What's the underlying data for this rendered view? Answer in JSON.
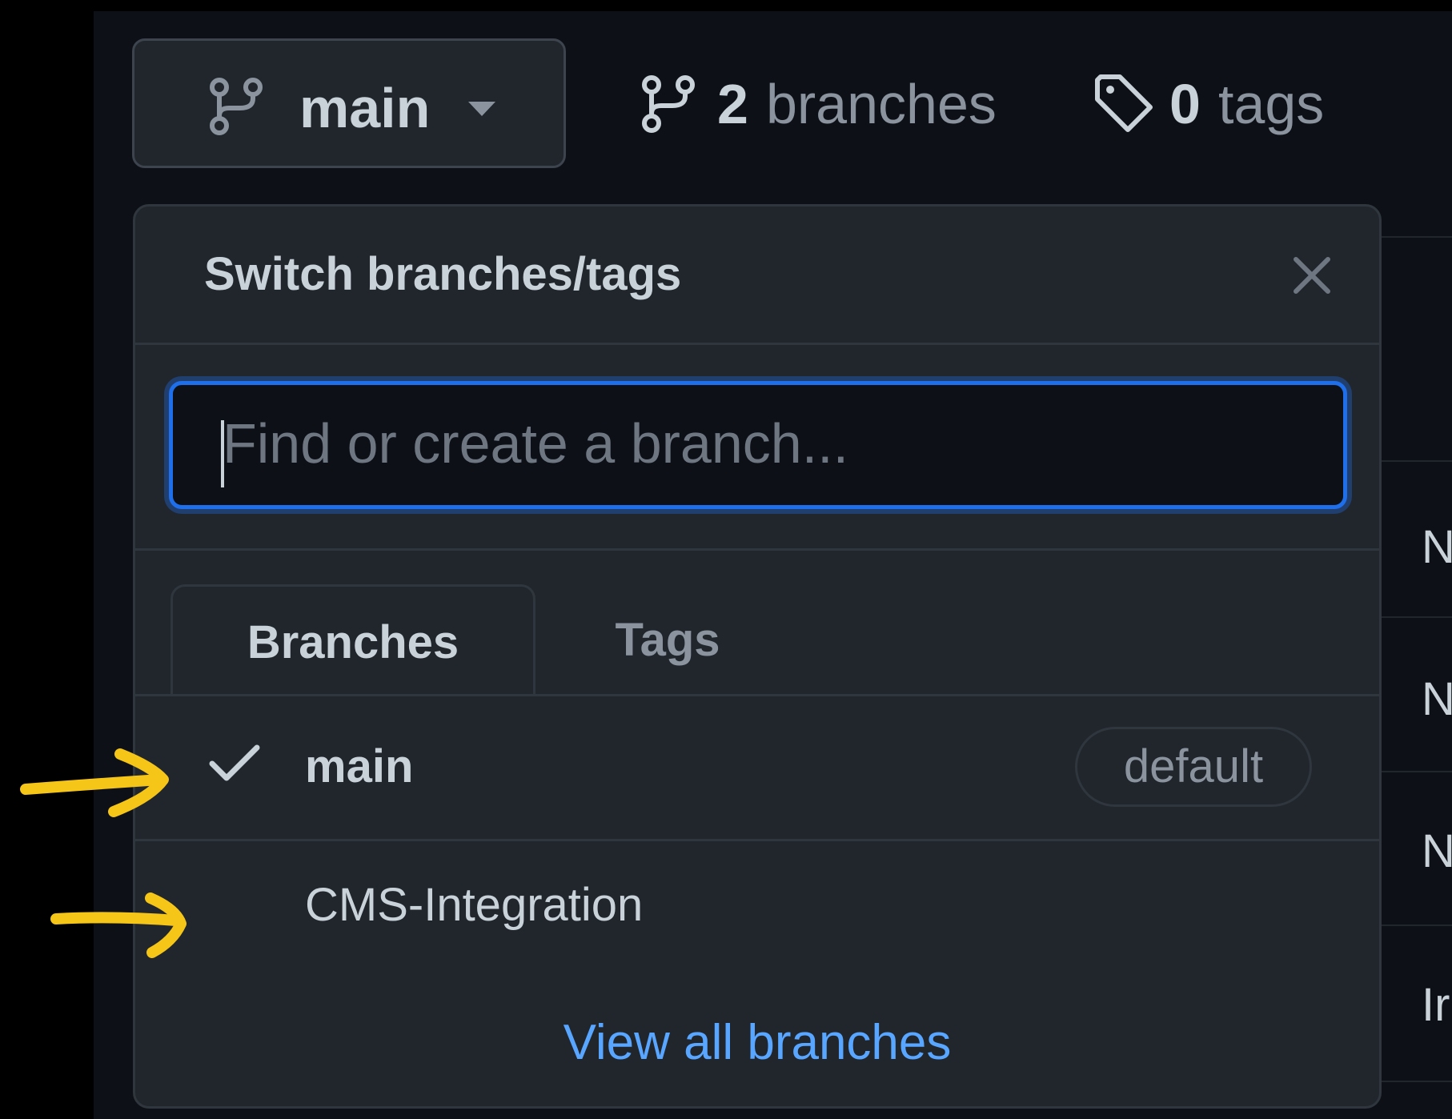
{
  "branch_button": {
    "label": "main"
  },
  "stats": {
    "branches_count": "2",
    "branches_label": "branches",
    "tags_count": "0",
    "tags_label": "tags"
  },
  "dropdown": {
    "title": "Switch branches/tags",
    "search_placeholder": "Find or create a branch...",
    "tabs": [
      {
        "label": "Branches",
        "active": true
      },
      {
        "label": "Tags",
        "active": false
      }
    ],
    "branches": [
      {
        "name": "main",
        "selected": true,
        "badge": "default"
      },
      {
        "name": "CMS-Integration",
        "selected": false
      }
    ],
    "view_all": "View all branches"
  },
  "background_letters": [
    "N",
    "N",
    "N",
    "Ir"
  ],
  "colors": {
    "accent": "#1f6feb",
    "link": "#58a6ff",
    "annotation_arrow": "#f5c518",
    "panel": "#21262d",
    "background": "#0d1117"
  }
}
